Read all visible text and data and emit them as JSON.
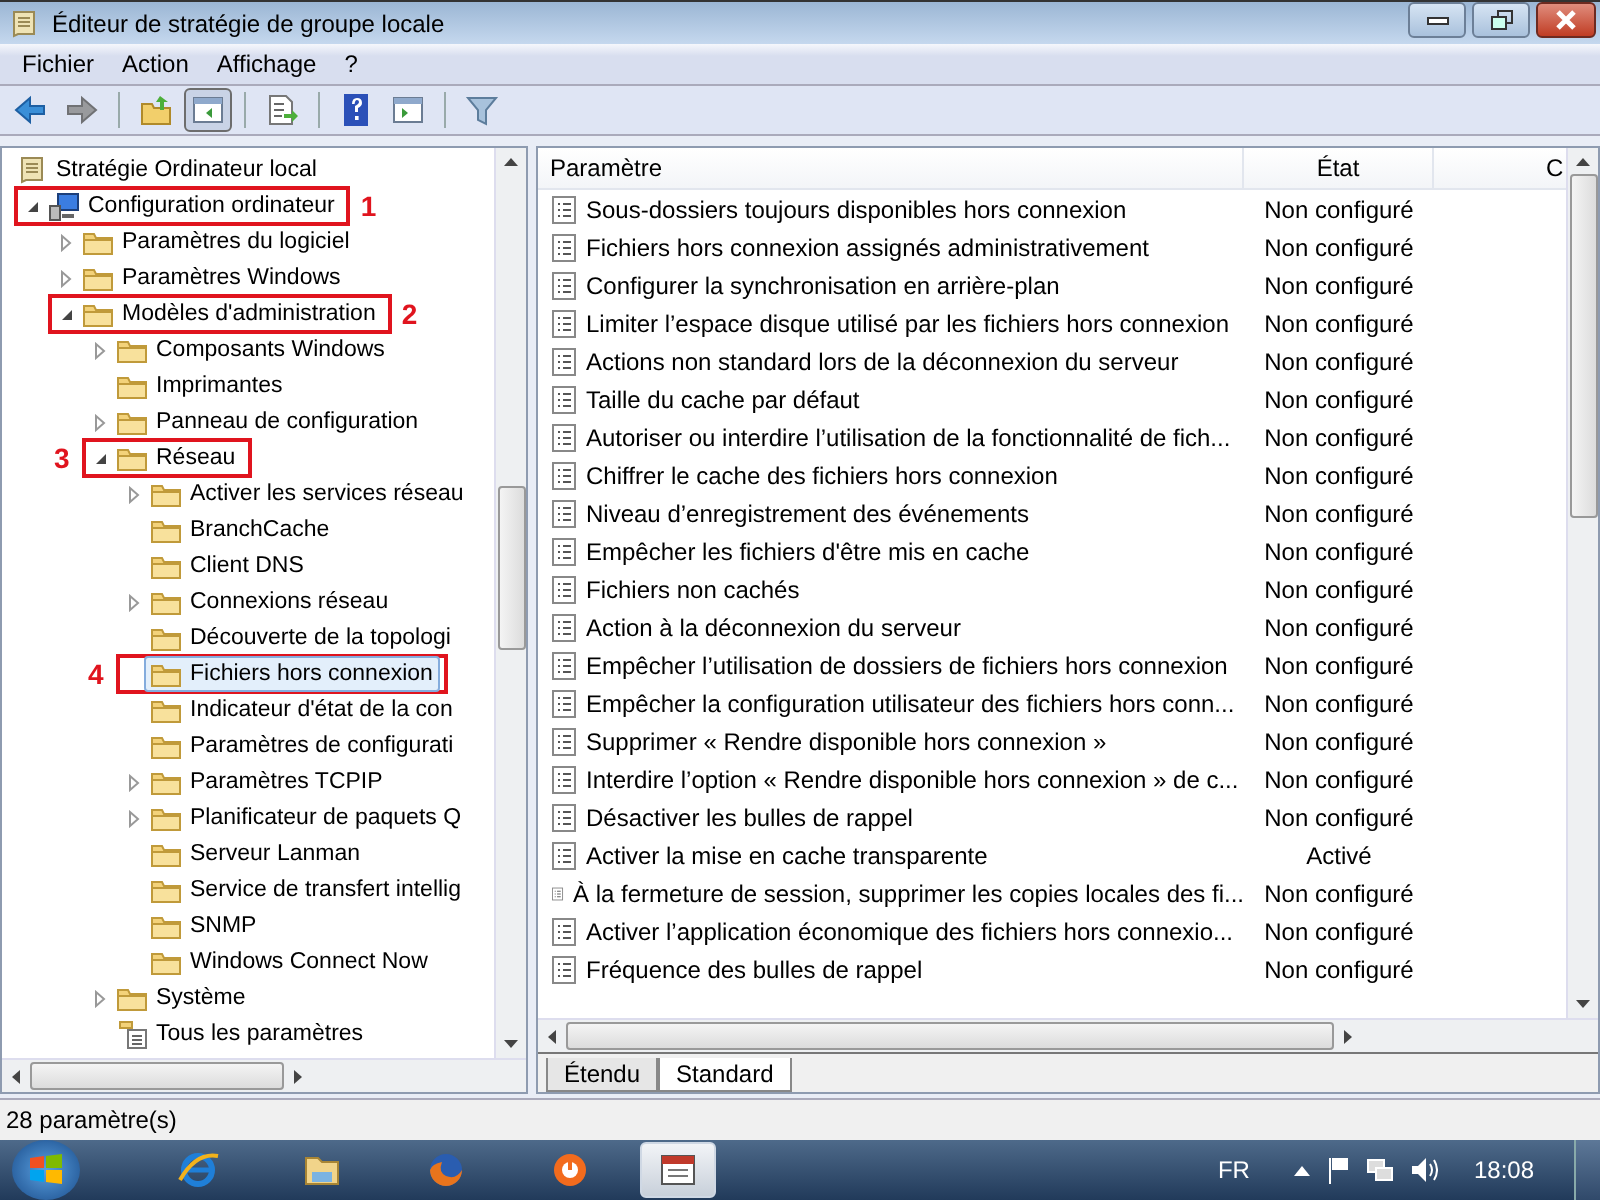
{
  "window": {
    "title": "Éditeur de stratégie de groupe locale"
  },
  "menu": [
    "Fichier",
    "Action",
    "Affichage",
    "?"
  ],
  "toolbar": {
    "groups": [
      {
        "buttons": [
          {
            "kind": "back",
            "pressed": false,
            "disabled": false
          },
          {
            "kind": "forward",
            "pressed": false,
            "disabled": true
          }
        ]
      },
      {
        "buttons": [
          {
            "kind": "up",
            "pressed": false,
            "disabled": false
          },
          {
            "kind": "tree-toggle",
            "pressed": true,
            "disabled": false
          }
        ]
      },
      {
        "buttons": [
          {
            "kind": "export",
            "pressed": false,
            "disabled": false
          }
        ]
      },
      {
        "buttons": [
          {
            "kind": "help",
            "pressed": false,
            "disabled": false
          },
          {
            "kind": "action-pane",
            "pressed": false,
            "disabled": false
          }
        ]
      },
      {
        "buttons": [
          {
            "kind": "filter",
            "pressed": false,
            "disabled": false
          }
        ]
      }
    ]
  },
  "tree": {
    "items": [
      {
        "label": "Stratégie Ordinateur local",
        "kind": "scroll",
        "selected": false,
        "children": [
          {
            "label": "Configuration ordinateur",
            "kind": "computer",
            "expanded": true,
            "selected": false,
            "callout": "1",
            "children": [
              {
                "label": "Paramètres du logiciel",
                "kind": "folder",
                "expanded": false,
                "selected": false
              },
              {
                "label": "Paramètres Windows",
                "kind": "folder",
                "expanded": false,
                "selected": false
              },
              {
                "label": "Modèles d'administration",
                "kind": "folder",
                "expanded": true,
                "selected": false,
                "callout": "2",
                "children": [
                  {
                    "label": "Composants Windows",
                    "kind": "folder",
                    "expanded": false,
                    "selected": false
                  },
                  {
                    "label": "Imprimantes",
                    "kind": "folder",
                    "selected": false
                  },
                  {
                    "label": "Panneau de configuration",
                    "kind": "folder",
                    "expanded": false,
                    "selected": false
                  },
                  {
                    "label": "Réseau",
                    "kind": "folder",
                    "expanded": true,
                    "selected": false,
                    "callout": "3",
                    "children": [
                      {
                        "label": "Activer les services réseau",
                        "kind": "folder",
                        "expanded": false,
                        "selected": false
                      },
                      {
                        "label": "BranchCache",
                        "kind": "folder",
                        "selected": false
                      },
                      {
                        "label": "Client DNS",
                        "kind": "folder",
                        "selected": false
                      },
                      {
                        "label": "Connexions réseau",
                        "kind": "folder",
                        "expanded": false,
                        "selected": false
                      },
                      {
                        "label": "Découverte de la topologi",
                        "kind": "folder",
                        "selected": false
                      },
                      {
                        "label": "Fichiers hors connexion",
                        "kind": "folder",
                        "selected": true,
                        "callout": "4"
                      },
                      {
                        "label": "Indicateur d'état de la con",
                        "kind": "folder",
                        "selected": false
                      },
                      {
                        "label": "Paramètres de configurati",
                        "kind": "folder",
                        "selected": false
                      },
                      {
                        "label": "Paramètres TCPIP",
                        "kind": "folder",
                        "expanded": false,
                        "selected": false
                      },
                      {
                        "label": "Planificateur de paquets Q",
                        "kind": "folder",
                        "expanded": false,
                        "selected": false
                      },
                      {
                        "label": "Serveur Lanman",
                        "kind": "folder",
                        "selected": false
                      },
                      {
                        "label": "Service de transfert intellig",
                        "kind": "folder",
                        "selected": false
                      },
                      {
                        "label": "SNMP",
                        "kind": "folder",
                        "selected": false
                      },
                      {
                        "label": "Windows Connect Now",
                        "kind": "folder",
                        "selected": false
                      }
                    ]
                  },
                  {
                    "label": "Système",
                    "kind": "folder",
                    "expanded": false,
                    "selected": false
                  },
                  {
                    "label": "Tous les paramètres",
                    "kind": "settings-list",
                    "selected": false
                  }
                ]
              }
            ]
          }
        ]
      }
    ]
  },
  "list": {
    "columns": [
      "Paramètre",
      "État",
      "C"
    ],
    "rows": [
      {
        "name": "Sous-dossiers toujours disponibles hors connexion",
        "state": "Non configuré"
      },
      {
        "name": "Fichiers hors connexion assignés administrativement",
        "state": "Non configuré"
      },
      {
        "name": "Configurer la synchronisation en arrière-plan",
        "state": "Non configuré"
      },
      {
        "name": "Limiter l’espace disque utilisé par les fichiers hors connexion",
        "state": "Non configuré"
      },
      {
        "name": "Actions non standard lors de la déconnexion du serveur",
        "state": "Non configuré"
      },
      {
        "name": "Taille du cache par défaut",
        "state": "Non configuré"
      },
      {
        "name": "Autoriser ou interdire l’utilisation de la fonctionnalité de fich...",
        "state": "Non configuré"
      },
      {
        "name": "Chiffrer le cache des fichiers hors connexion",
        "state": "Non configuré"
      },
      {
        "name": "Niveau d’enregistrement des événements",
        "state": "Non configuré"
      },
      {
        "name": "Empêcher les fichiers d'être mis en cache",
        "state": "Non configuré"
      },
      {
        "name": "Fichiers non cachés",
        "state": "Non configuré"
      },
      {
        "name": "Action à la déconnexion du serveur",
        "state": "Non configuré"
      },
      {
        "name": "Empêcher l’utilisation de dossiers de fichiers hors connexion",
        "state": "Non configuré"
      },
      {
        "name": "Empêcher la configuration utilisateur des fichiers hors conn...",
        "state": "Non configuré"
      },
      {
        "name": "Supprimer « Rendre disponible hors connexion »",
        "state": "Non configuré"
      },
      {
        "name": "Interdire l’option « Rendre disponible hors connexion » de c...",
        "state": "Non configuré"
      },
      {
        "name": "Désactiver les bulles de rappel",
        "state": "Non configuré"
      },
      {
        "name": "Activer la mise en cache transparente",
        "state": "Activé"
      },
      {
        "name": "À la fermeture de session, supprimer les copies locales des fi...",
        "state": "Non configuré"
      },
      {
        "name": "Activer l’application économique des fichiers hors connexio...",
        "state": "Non configuré"
      },
      {
        "name": "Fréquence des bulles de rappel",
        "state": "Non configuré"
      }
    ],
    "tabs": [
      {
        "label": "Étendu",
        "selected": false
      },
      {
        "label": "Standard",
        "selected": true
      }
    ]
  },
  "status_bar": {
    "text": "28 paramètre(s)"
  },
  "taskbar": {
    "apps": [
      {
        "kind": "browser",
        "active": false
      },
      {
        "kind": "folder",
        "active": false
      },
      {
        "kind": "fox",
        "active": false
      },
      {
        "kind": "ring",
        "active": false
      },
      {
        "kind": "window",
        "active": true
      }
    ],
    "language": "FR",
    "clock": "18:08"
  }
}
